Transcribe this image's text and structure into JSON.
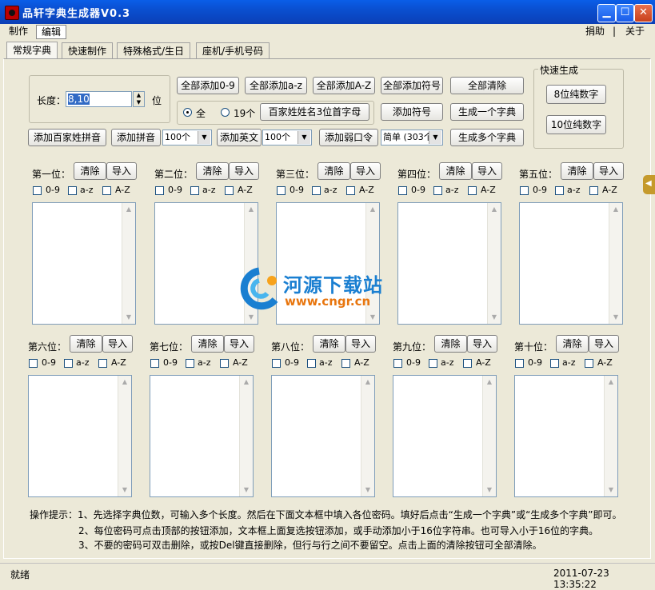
{
  "window": {
    "title": "品轩字典生成器V0.3"
  },
  "menubar": {
    "items": [
      "制作",
      "编辑"
    ],
    "right": [
      "捐助",
      "|",
      "关于"
    ]
  },
  "tabs": [
    "常规字典",
    "快速制作",
    "特殊格式/生日",
    "座机/手机号码"
  ],
  "length": {
    "label": "长度：",
    "value": "8,10",
    "unit": "位"
  },
  "buttons": {
    "add_digits": "全部添加0-9",
    "add_lower": "全部添加a-z",
    "add_upper": "全部添加A-Z",
    "add_symbols": "全部添加符号",
    "clear_all": "全部清除",
    "surname_initials": "百家姓姓名3位首字母",
    "add_symbol": "添加符号",
    "gen_one": "生成一个字典",
    "add_surname_pinyin": "添加百家姓拼音",
    "add_pinyin": "添加拼音",
    "add_english": "添加英文",
    "add_weak": "添加弱口令",
    "gen_many": "生成多个字典"
  },
  "radio": {
    "all_label": "全",
    "nineteen_label": "19个"
  },
  "selects": {
    "pinyin": "100个",
    "english": "100个",
    "weak": "简单 (303个"
  },
  "quick": {
    "title": "快速生成",
    "btn8": "8位纯数字",
    "btn10": "10位纯数字"
  },
  "positions": [
    "第一位：",
    "第二位：",
    "第三位：",
    "第四位：",
    "第五位：",
    "第六位：",
    "第七位：",
    "第八位：",
    "第九位：",
    "第十位："
  ],
  "position_buttons": {
    "clear": "清除",
    "import": "导入"
  },
  "checks": {
    "digits": "0-9",
    "lower": "a-z",
    "upper": "A-Z"
  },
  "watermark": {
    "name": "河源下载站",
    "url": "www.cngr.cn"
  },
  "hints": [
    "操作提示：1、先选择字典位数，可输入多个长度。然后在下面文本框中填入各位密码。填好后点击“生成一个字典”或“生成多个字典”即可。",
    "2、每位密码可点击顶部的按钮添加，文本框上面复选按钮添加，或手动添加小于16位字符串。也可导入小于16位的字典。",
    "3、不要的密码可双击删除，或按Del键直接删除，但行与行之间不要留空。点击上面的清除按钮可全部清除。"
  ],
  "status": {
    "left": "就绪",
    "right": "2011-07-23 13:35:22"
  }
}
